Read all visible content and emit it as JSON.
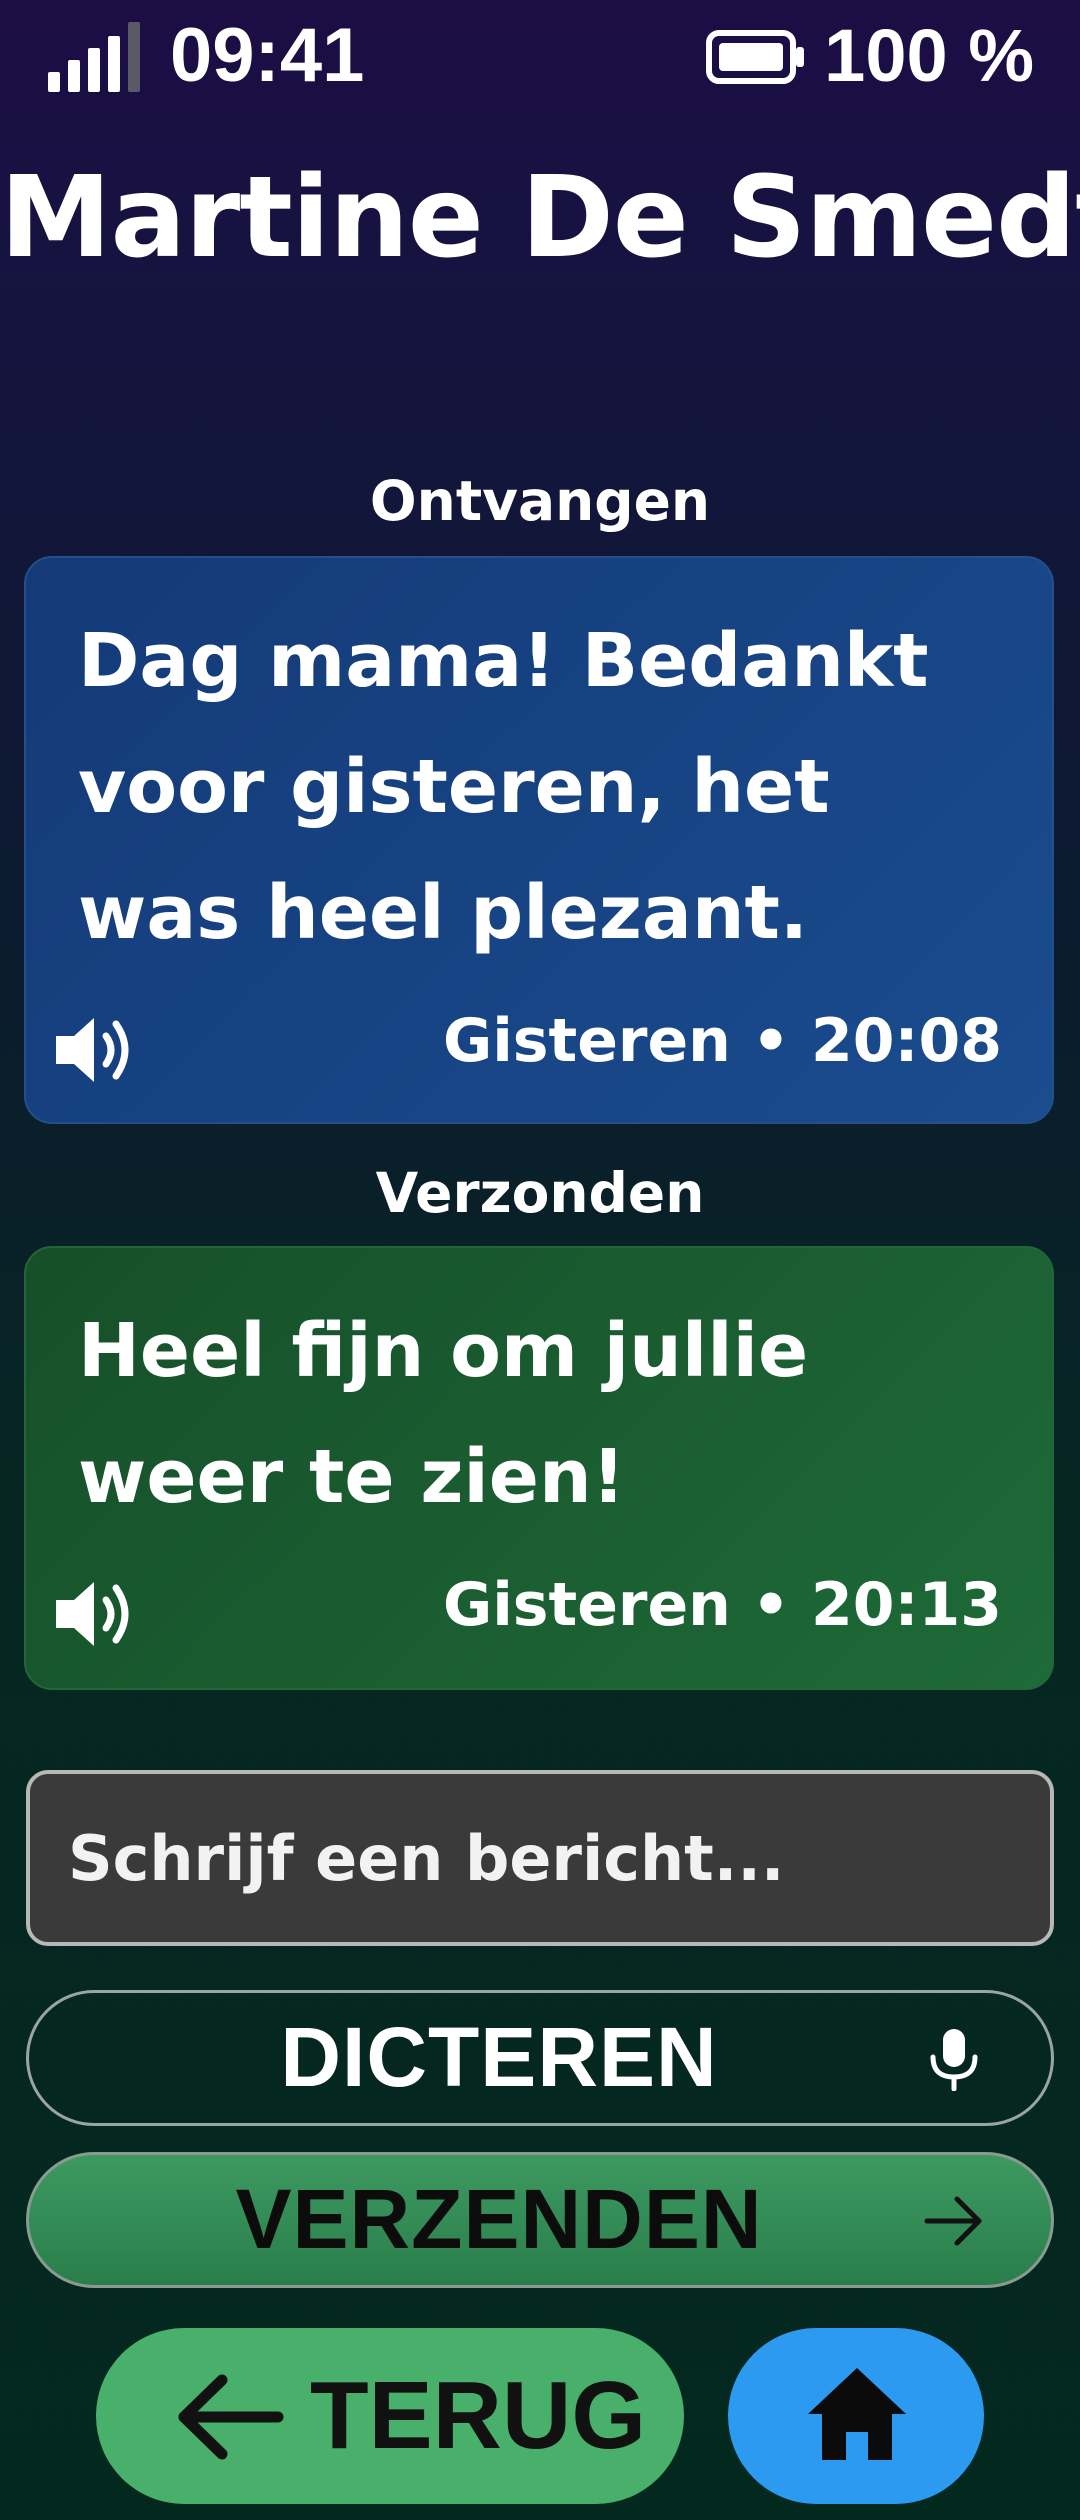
{
  "status_bar": {
    "time": "09:41",
    "battery_percent": "100 %",
    "signal_bars_filled": 4,
    "signal_bars_total": 5,
    "icons": [
      "signal-icon",
      "battery-icon"
    ]
  },
  "header": {
    "contact_name": "Martine De Smedt"
  },
  "messages": [
    {
      "section_label": "Ontvangen",
      "direction": "received",
      "text": "Dag mama! Bedankt voor gisteren, het was heel plezant.",
      "timestamp": "Gisteren • 20:08",
      "icon": "speaker-icon",
      "color": "#1a4c8e"
    },
    {
      "section_label": "Verzonden",
      "direction": "sent",
      "text": "Heel fijn om jullie weer te zien!",
      "timestamp": "Gisteren • 20:13",
      "icon": "speaker-icon",
      "color": "#1e6a38"
    }
  ],
  "compose": {
    "placeholder": "Schrijf een bericht...",
    "value": ""
  },
  "actions": {
    "dictate_label": "DICTEREN",
    "dictate_icon": "microphone-icon",
    "send_label": "VERZENDEN",
    "send_icon": "arrow-right-icon",
    "send_color": "#2a7e4b"
  },
  "nav": {
    "back_label": "TERUG",
    "back_icon": "arrow-left-icon",
    "back_color": "#48b06a",
    "home_icon": "home-icon",
    "home_color": "#2c9af0"
  }
}
